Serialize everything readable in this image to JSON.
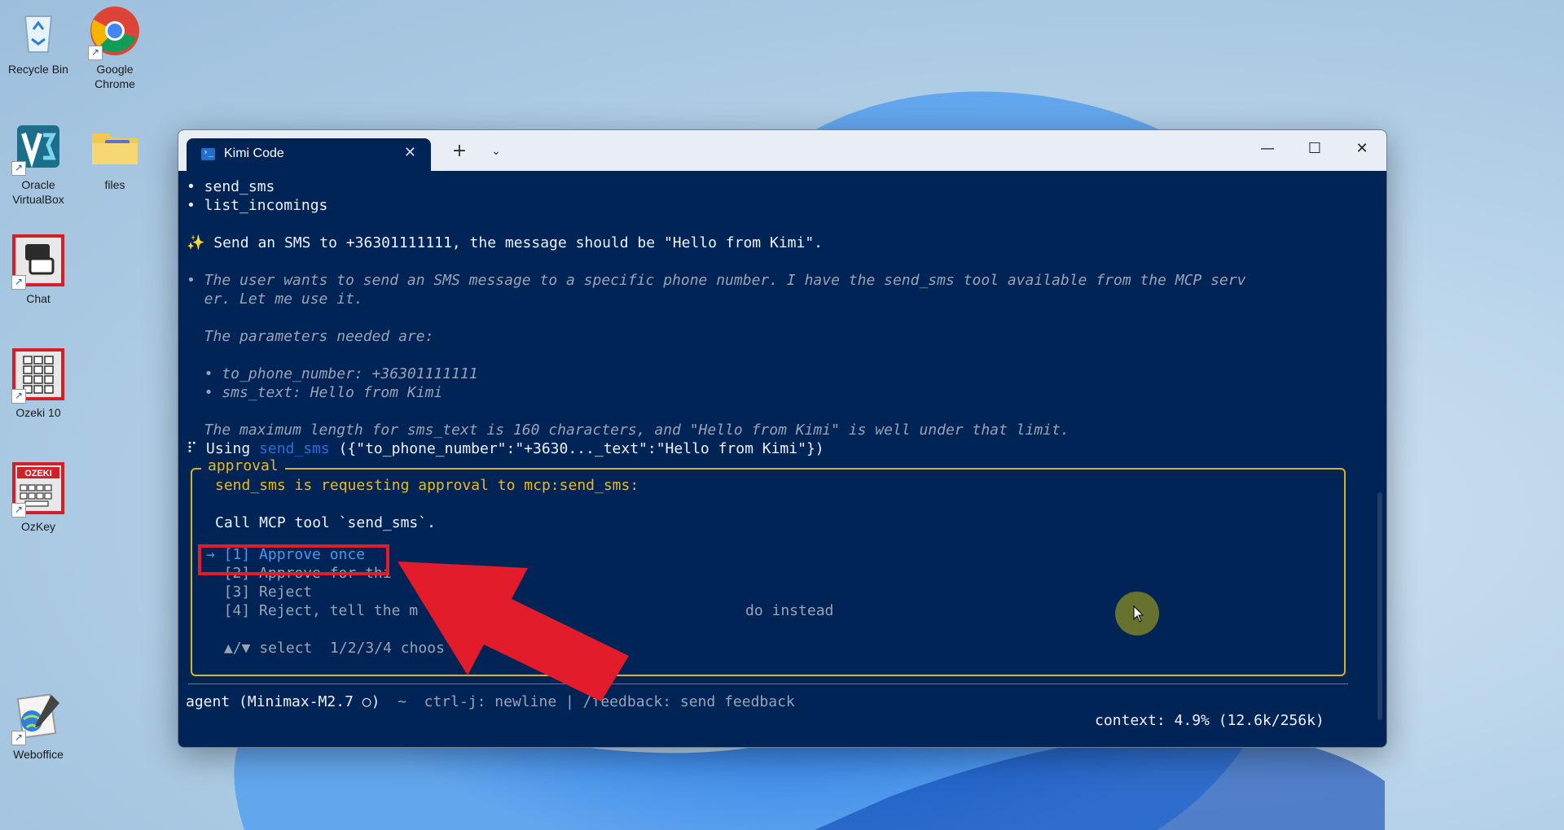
{
  "desktop": {
    "icons": [
      {
        "label": "Recycle Bin"
      },
      {
        "label": "Google Chrome"
      },
      {
        "label": "Oracle VirtualBox"
      },
      {
        "label": "files"
      },
      {
        "label": "Chat"
      },
      {
        "label": "Ozeki 10"
      },
      {
        "label": "OzKey"
      },
      {
        "label": "Weboffice"
      }
    ],
    "ozkey_badge": "OZEKI"
  },
  "window": {
    "tab_title": "Kimi Code",
    "new_tab": "+",
    "dropdown": "⌄",
    "minimize": "—",
    "maximize": "☐",
    "close": "✕"
  },
  "terminal": {
    "bullet_1": "• send_sms",
    "bullet_2": "• list_incomings",
    "prompt_icon": "✨",
    "prompt": " Send an SMS to +36301111111, the message should be \"Hello from Kimi\".",
    "thinking_1": "• The user wants to send an SMS message to a specific phone number. I have the send_sms tool available from the MCP serv",
    "thinking_2": "  er. Let me use it.",
    "params_title": "  The parameters needed are:",
    "param_1": "  • to_phone_number: +36301111111",
    "param_2": "  • sms_text: Hello from Kimi",
    "limit_note": "  The maximum length for sms_text is 160 characters, and \"Hello from Kimi\" is well under that limit.",
    "using_prefix": "⠏ Using ",
    "using_tool": "send_sms",
    "using_args": " ({\"to_phone_number\":\"+3630..._text\":\"Hello from Kimi\"})",
    "approval": {
      "title": "approval",
      "request": "send_sms is requesting approval to mcp:send_sms:",
      "call": "Call MCP tool `send_sms`.",
      "options": [
        "→ [1] Approve once",
        "  [2] Approve for thi",
        "  [3] Reject",
        "  [4] Reject, tell the m",
        "do instead"
      ],
      "hint": "▲/▼ select  1/2/3/4 choos"
    },
    "status_mode": "agent (Minimax-M2.7 ○)",
    "status_sep": "  ~  ",
    "status_hints": "ctrl-j: newline | /feedback: send feedback",
    "context": "context: 4.9% (12.6k/256k)"
  },
  "colors": {
    "terminal_bg": "#012456",
    "approval_border": "#d7b227",
    "highlight": "#e21c2a",
    "selected_option": "#4f98e6"
  }
}
